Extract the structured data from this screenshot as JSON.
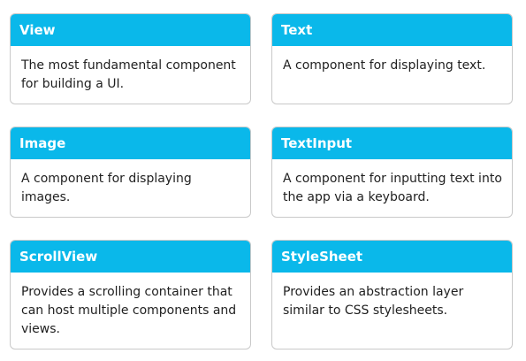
{
  "cards": [
    {
      "title": "View",
      "description": "The most fundamental component for building a UI."
    },
    {
      "title": "Text",
      "description": "A component for displaying text."
    },
    {
      "title": "Image",
      "description": "A component for displaying images."
    },
    {
      "title": "TextInput",
      "description": "A component for inputting text into the app via a keyboard."
    },
    {
      "title": "ScrollView",
      "description": "Provides a scrolling container that can host multiple components and views."
    },
    {
      "title": "StyleSheet",
      "description": "Provides an abstraction layer similar to CSS stylesheets."
    }
  ],
  "colors": {
    "header_bg": "#0ab8ea",
    "header_text": "#ffffff",
    "border": "#c9c9c9",
    "body_text": "#1f1f1f"
  }
}
